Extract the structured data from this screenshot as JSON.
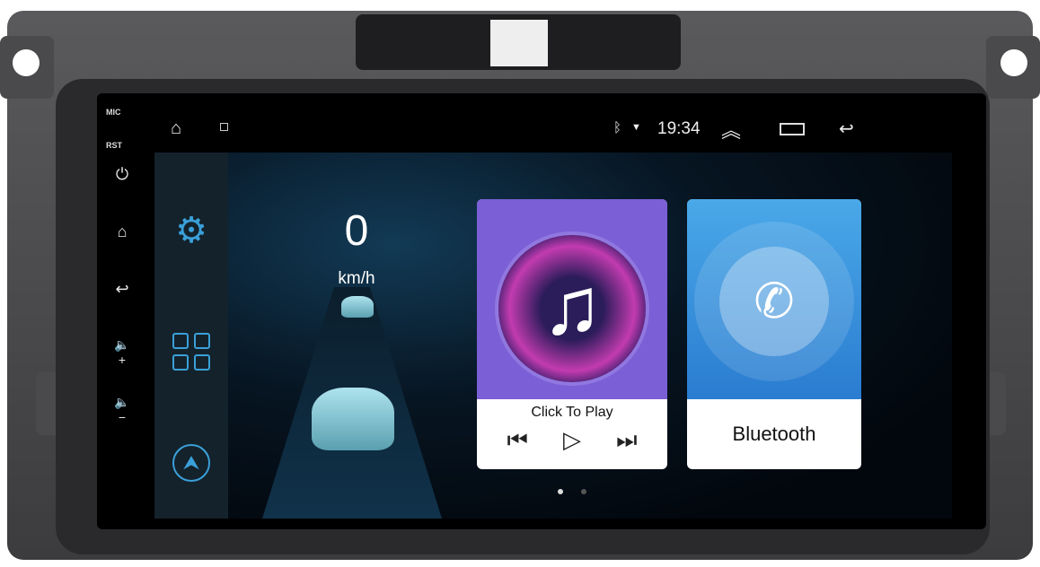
{
  "hardware_buttons": {
    "mic": "MIC",
    "rst": "RST"
  },
  "status_bar": {
    "time": "19:34"
  },
  "dashboard": {
    "speed": "0",
    "unit": "km/h"
  },
  "music_card": {
    "label": "Click To Play"
  },
  "bluetooth_card": {
    "label": "Bluetooth"
  },
  "colors": {
    "music": "#7b5fd6",
    "bluetooth": "#3a92de",
    "sidebar_icon": "#3aa0d8"
  },
  "pager": {
    "pages": 2,
    "current": 1
  }
}
